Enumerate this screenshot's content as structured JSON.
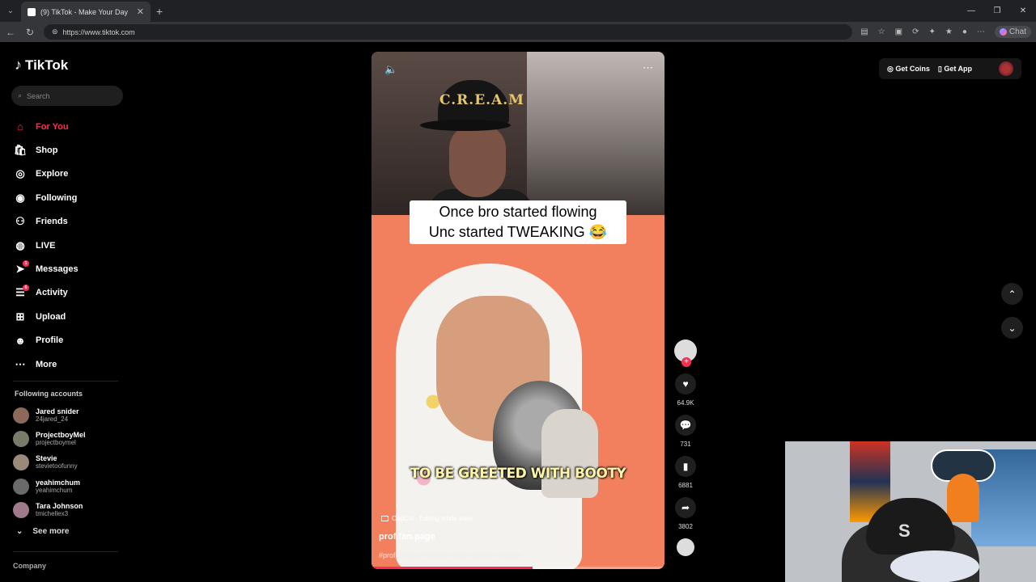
{
  "browser": {
    "tab_title": "(9) TikTok - Make Your Day",
    "url": "https://www.tiktok.com",
    "chat_label": "Chat"
  },
  "sidebar": {
    "logo": "TikTok",
    "search_placeholder": "Search",
    "nav": [
      {
        "label": "For You",
        "icon": "home-icon",
        "active": true
      },
      {
        "label": "Shop",
        "icon": "shop-icon"
      },
      {
        "label": "Explore",
        "icon": "compass-icon"
      },
      {
        "label": "Following",
        "icon": "following-icon"
      },
      {
        "label": "Friends",
        "icon": "friends-icon"
      },
      {
        "label": "LIVE",
        "icon": "live-icon"
      },
      {
        "label": "Messages",
        "icon": "messages-icon",
        "badge": "1"
      },
      {
        "label": "Activity",
        "icon": "activity-icon",
        "badge": "6"
      },
      {
        "label": "Upload",
        "icon": "upload-icon"
      },
      {
        "label": "Profile",
        "icon": "profile-icon"
      },
      {
        "label": "More",
        "icon": "more-icon"
      }
    ],
    "following_title": "Following accounts",
    "following": [
      {
        "name": "Jared snider",
        "handle": "24jared_24"
      },
      {
        "name": "ProjectboyMel",
        "handle": "projectboymel"
      },
      {
        "name": "Stevie",
        "handle": "stevietoofunny"
      },
      {
        "name": "yeahimchum",
        "handle": "yeahimchum"
      },
      {
        "name": "Tara Johnson",
        "handle": "tmichellex3"
      }
    ],
    "see_more": "See more",
    "company": "Company"
  },
  "video": {
    "cap_text": "C.R.E.A.M",
    "caption_line1": "Once bro started flowing",
    "caption_line2": "Unc started TWEAKING 😂",
    "subtitle": "TO BE GREETED WITH BOOTY",
    "capcut": "CapCut · Editing made easy",
    "username": "prof.fan.page",
    "hashtags": "#profgampo #reaction #rap #hiphop #rapper",
    "progress": 0.55
  },
  "actions": {
    "likes": "64.9K",
    "comments": "731",
    "saves": "6881",
    "shares": "3802"
  },
  "topright": {
    "coins": "Get Coins",
    "app": "Get App"
  },
  "colors": {
    "accent": "#fe2c55",
    "background": "#000000",
    "video_bg": "#f2805f"
  }
}
